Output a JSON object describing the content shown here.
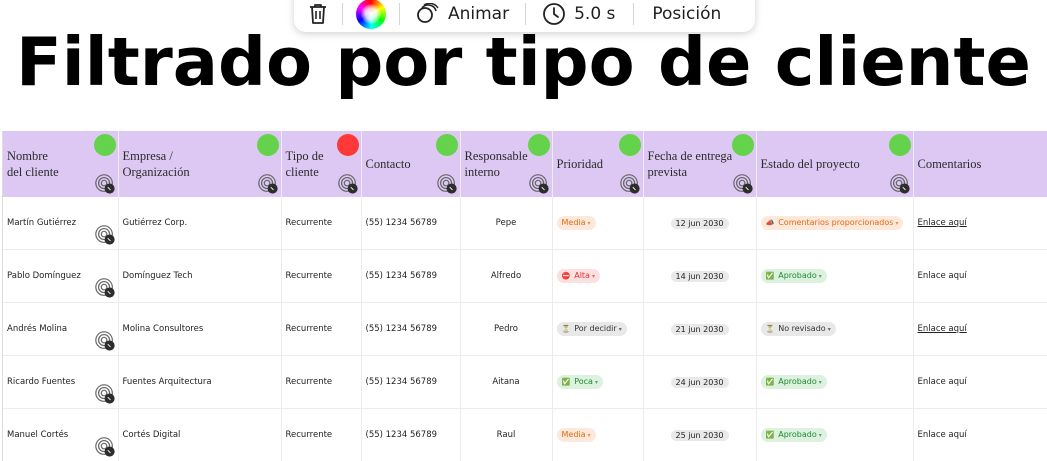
{
  "toolbar": {
    "delete_icon": "trash-icon",
    "color_icon": "color-wheel-icon",
    "animate_icon": "animate-icon",
    "animate_label": "Animar",
    "timer_icon": "clock-icon",
    "duration_label": "5.0 s",
    "position_label": "Posición"
  },
  "title": "Filtrado por tipo de cliente",
  "colors": {
    "header_bg": "#dcc8f3",
    "dot_green": "#64d24a",
    "dot_red": "#ff3838"
  },
  "table": {
    "headers": [
      {
        "label": "Nombre\ndel cliente",
        "dot": "green"
      },
      {
        "label": "Empresa / Organización",
        "dot": "green"
      },
      {
        "label": "Tipo de cliente",
        "dot": "red"
      },
      {
        "label": "Contacto",
        "dot": "green"
      },
      {
        "label": "Responsable interno",
        "dot": "green"
      },
      {
        "label": "Prioridad",
        "dot": "green"
      },
      {
        "label": "Fecha de entrega prevista",
        "dot": "green"
      },
      {
        "label": "Estado del proyecto",
        "dot": "green"
      },
      {
        "label": "Comentarios",
        "dot": "green"
      }
    ],
    "rows": [
      {
        "nombre": "Martín Gutiérrez",
        "empresa": "Gutiérrez Corp.",
        "tipo": "Recurrente",
        "contacto": "(55) 1234 56789",
        "responsable": "Pepe",
        "prioridad": {
          "label": "Media",
          "icon": "",
          "style": "orange"
        },
        "fecha": "12 jun 2030",
        "estado": {
          "label": "Comentarios proporcionados",
          "icon": "📣",
          "style": "orange"
        },
        "comentario": "Enlace aquí",
        "comentario_underline": true
      },
      {
        "nombre": "Pablo Domínguez",
        "empresa": "Domínguez Tech",
        "tipo": "Recurrente",
        "contacto": "(55) 1234 56789",
        "responsable": "Alfredo",
        "prioridad": {
          "label": "Alta",
          "icon": "⛔",
          "style": "red"
        },
        "fecha": "14 jun 2030",
        "estado": {
          "label": "Aprobado",
          "icon": "✅",
          "style": "green"
        },
        "comentario": "Enlace aquí",
        "comentario_underline": false
      },
      {
        "nombre": "Andrés Molina",
        "empresa": "Molina Consultores",
        "tipo": "Recurrente",
        "contacto": "(55) 1234 56789",
        "responsable": "Pedro",
        "prioridad": {
          "label": "Por decidir",
          "icon": "⏳",
          "style": "gray"
        },
        "fecha": "21 jun 2030",
        "estado": {
          "label": "No revisado",
          "icon": "⏳",
          "style": "gray"
        },
        "comentario": "Enlace aquí",
        "comentario_underline": true
      },
      {
        "nombre": "Ricardo Fuentes",
        "empresa": "Fuentes Arquitectura",
        "tipo": "Recurrente",
        "contacto": "(55) 1234 56789",
        "responsable": "Aitana",
        "prioridad": {
          "label": "Poca",
          "icon": "✅",
          "style": "green"
        },
        "fecha": "24 jun 2030",
        "estado": {
          "label": "Aprobado",
          "icon": "✅",
          "style": "green"
        },
        "comentario": "Enlace aquí",
        "comentario_underline": false
      },
      {
        "nombre": "Manuel Cortés",
        "empresa": "Cortés Digital",
        "tipo": "Recurrente",
        "contacto": "(55) 1234 56789",
        "responsable": "Raul",
        "prioridad": {
          "label": "Media",
          "icon": "",
          "style": "orange"
        },
        "fecha": "25 jun 2030",
        "estado": {
          "label": "Aprobado",
          "icon": "✅",
          "style": "green"
        },
        "comentario": "Enlace aquí",
        "comentario_underline": false
      }
    ]
  }
}
